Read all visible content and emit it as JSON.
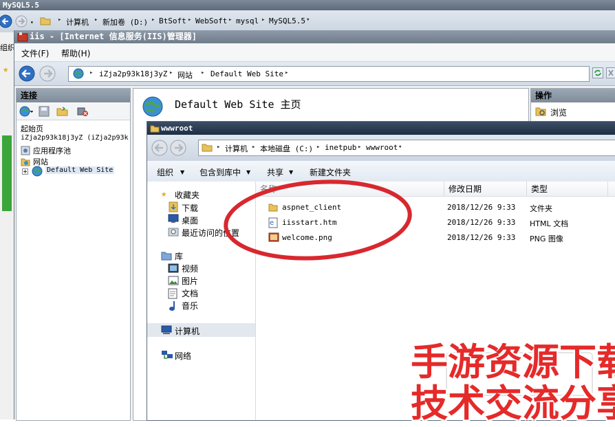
{
  "background_window": {
    "title": "MySQL5.5",
    "breadcrumb": [
      "计算机",
      "新加卷 (D:)",
      "BtSoft",
      "WebSoft",
      "mysql",
      "MySQL5.5"
    ],
    "left_labels": [
      "组织"
    ]
  },
  "iis": {
    "title": "iis - [Internet 信息服务(IIS)管理器]",
    "menu": [
      "文件(F)",
      "帮助(H)"
    ],
    "breadcrumb": [
      "iZja2p93k18j3yZ",
      "网站",
      "Default Web Site"
    ],
    "connections": {
      "header": "连接",
      "tree": [
        "起始页",
        "iZja2p93k18j3yZ (iZja2p93k",
        "应用程序池",
        "网站",
        "Default Web Site"
      ]
    },
    "main_title": "Default Web Site 主页",
    "operations": {
      "header": "操作",
      "items": [
        "浏览"
      ]
    }
  },
  "explorer": {
    "title": "wwwroot",
    "breadcrumb": [
      "计算机",
      "本地磁盘 (C:)",
      "inetpub",
      "wwwroot"
    ],
    "toolbar": [
      "组织",
      "包含到库中",
      "共享",
      "新建文件夹"
    ],
    "nav": {
      "favorites": "收藏夹",
      "favorite_items": [
        "下载",
        "桌面",
        "最近访问的位置"
      ],
      "libraries": "库",
      "library_items": [
        "视频",
        "图片",
        "文档",
        "音乐"
      ],
      "computer": "计算机",
      "network": "网络"
    },
    "columns": [
      "名称",
      "修改日期",
      "类型"
    ],
    "files": [
      {
        "name": "aspnet_client",
        "date": "2018/12/26 9:33",
        "type": "文件夹",
        "icon": "folder-icon"
      },
      {
        "name": "iisstart.htm",
        "date": "2018/12/26 9:33",
        "type": "HTML 文档",
        "icon": "html-file-icon"
      },
      {
        "name": "welcome.png",
        "date": "2018/12/26 9:33",
        "type": "PNG 图像",
        "icon": "png-file-icon"
      }
    ]
  },
  "watermark": {
    "line1": "手游资源下载",
    "line2": "技术交流分享",
    "color": "#e52a2a"
  },
  "annotation_color": "#d8282f"
}
